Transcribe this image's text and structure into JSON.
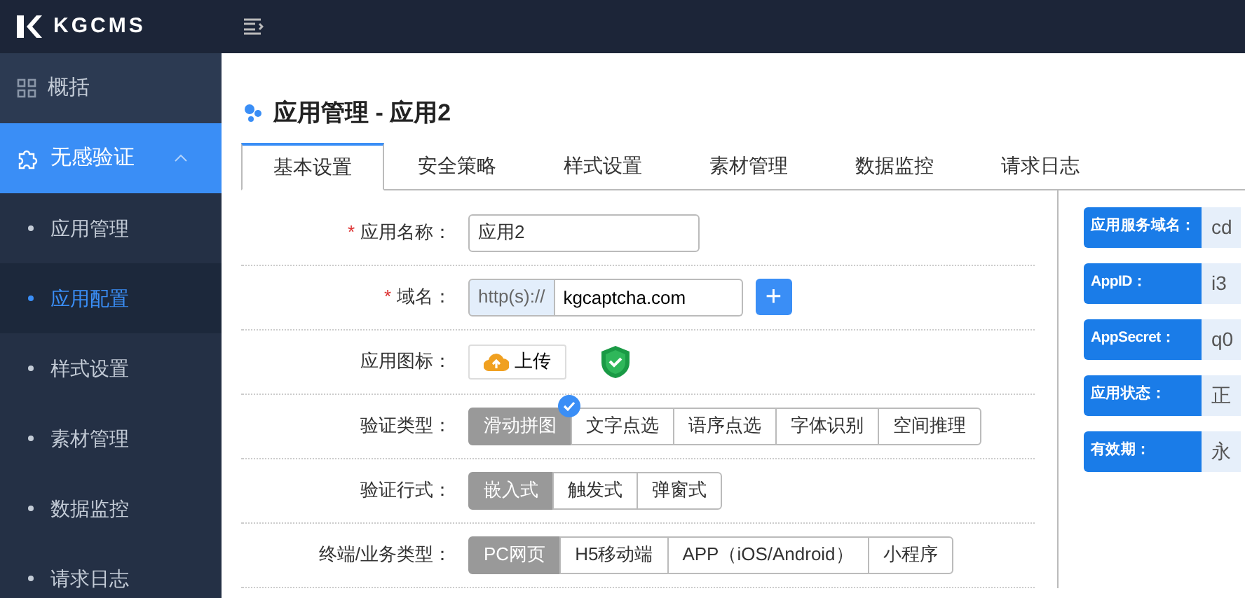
{
  "brand": {
    "logo": "KGCMS"
  },
  "sidebar": [
    {
      "label": "概括",
      "kind": "link",
      "selected": false
    },
    {
      "label": "无感验证",
      "kind": "group",
      "selected": true,
      "expanded": true,
      "children": [
        {
          "label": "应用管理",
          "selected": false
        },
        {
          "label": "应用配置",
          "selected": true
        },
        {
          "label": "样式设置",
          "selected": false
        },
        {
          "label": "素材管理",
          "selected": false
        },
        {
          "label": "数据监控",
          "selected": false
        },
        {
          "label": "请求日志",
          "selected": false
        }
      ]
    }
  ],
  "page_title": "应用管理 - 应用2",
  "tabs": [
    {
      "label": "基本设置",
      "selected": true
    },
    {
      "label": "安全策略",
      "selected": false
    },
    {
      "label": "样式设置",
      "selected": false
    },
    {
      "label": "素材管理",
      "selected": false
    },
    {
      "label": "数据监控",
      "selected": false
    },
    {
      "label": "请求日志",
      "selected": false
    }
  ],
  "form": [
    {
      "kind": "text",
      "label": "应用名称：",
      "required_mark": "*",
      "value": "应用2"
    },
    {
      "kind": "domain",
      "label": "域名：",
      "required_mark": "*",
      "prefix": "http(s)://",
      "value": "kgcaptcha.com",
      "add_button": "+"
    },
    {
      "kind": "upload",
      "label": "应用图标：",
      "button": "上传"
    },
    {
      "kind": "segmented",
      "label": "验证类型：",
      "pointer_on_selected": true,
      "options": [
        {
          "label": "滑动拼图",
          "selected": true
        },
        {
          "label": "文字点选",
          "selected": false
        },
        {
          "label": "语序点选",
          "selected": false
        },
        {
          "label": "字体识别",
          "selected": false
        },
        {
          "label": "空间推理",
          "selected": false
        }
      ]
    },
    {
      "kind": "segmented",
      "label": "验证行式：",
      "options": [
        {
          "label": "嵌入式",
          "selected": true
        },
        {
          "label": "触发式",
          "selected": false
        },
        {
          "label": "弹窗式",
          "selected": false
        }
      ]
    },
    {
      "kind": "segmented",
      "label": "终端/业务类型：",
      "options": [
        {
          "label": "PC网页",
          "selected": true
        },
        {
          "label": "H5移动端",
          "selected": false
        },
        {
          "label": "APP（iOS/Android）",
          "selected": false
        },
        {
          "label": "小程序",
          "selected": false
        }
      ]
    }
  ],
  "info": [
    {
      "label": "应用服务域名：",
      "value": "cd"
    },
    {
      "label": "AppID：",
      "value": "i3"
    },
    {
      "label": "AppSecret：",
      "value": "q0"
    },
    {
      "label": "应用状态：",
      "value": "正"
    },
    {
      "label": "有效期：",
      "value": "永"
    }
  ]
}
